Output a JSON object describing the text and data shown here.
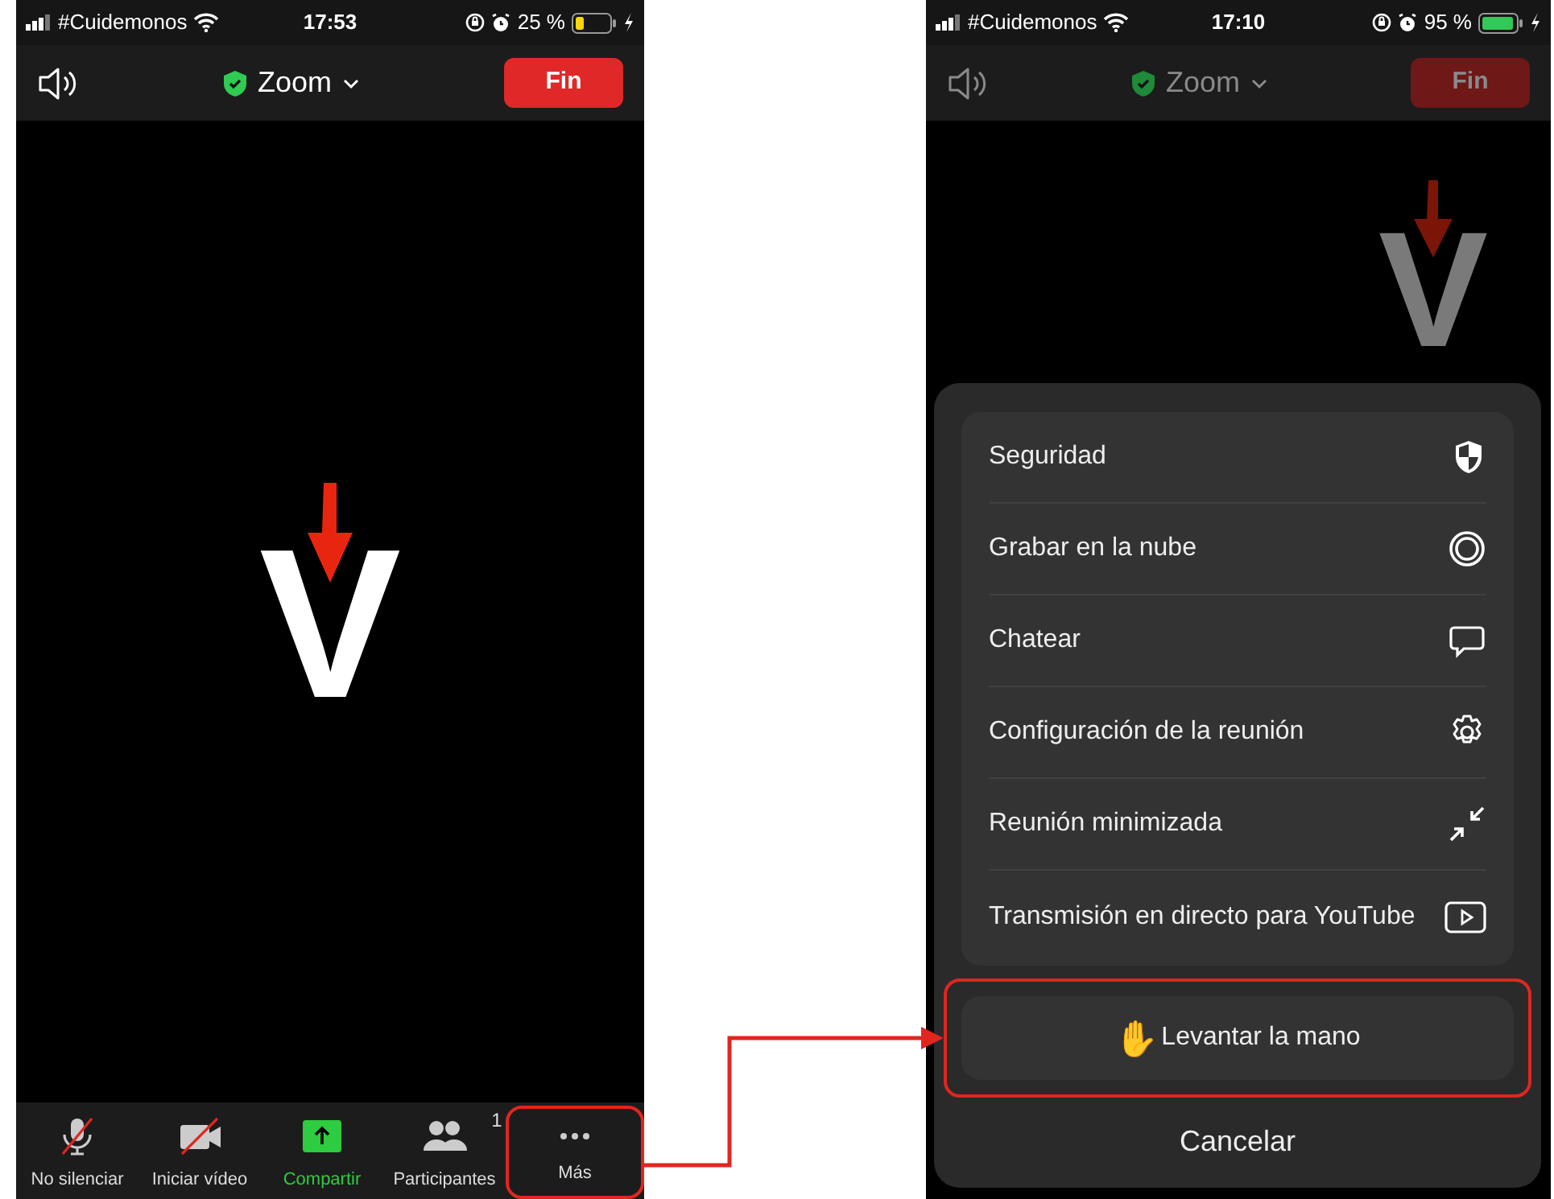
{
  "screens": [
    {
      "status_bar": {
        "carrier": "#Cuidemonos",
        "time": "17:53",
        "battery": {
          "text": "25 %",
          "color": "#ffd60a"
        }
      },
      "header": {
        "title": "Zoom",
        "end_button": "Fin",
        "dimmed": false
      },
      "video": {
        "avatar": "V",
        "dimmed": false
      },
      "toolbar": [
        {
          "kind": "mic",
          "label": "No silenciar",
          "highlighted": false
        },
        {
          "kind": "video",
          "label": "Iniciar vídeo",
          "highlighted": false
        },
        {
          "kind": "share",
          "label": "Compartir",
          "highlighted": false
        },
        {
          "kind": "participants",
          "label": "Participantes",
          "count": "1",
          "highlighted": false
        },
        {
          "kind": "more",
          "label": "Más",
          "highlighted": true
        }
      ]
    },
    {
      "status_bar": {
        "carrier": "#Cuidemonos",
        "time": "17:10",
        "battery": {
          "text": "95 %",
          "color": "#34c759"
        }
      },
      "header": {
        "title": "Zoom",
        "end_button": "Fin",
        "dimmed": true
      },
      "video": {
        "avatar": "V",
        "dimmed": true
      },
      "sheet": {
        "items": [
          {
            "kind": "security",
            "label": "Seguridad"
          },
          {
            "kind": "record",
            "label": "Grabar en la nube"
          },
          {
            "kind": "chat",
            "label": "Chatear"
          },
          {
            "kind": "settings",
            "label": "Configuración de la reunión"
          },
          {
            "kind": "minimize",
            "label": "Reunión minimizada"
          },
          {
            "kind": "youtube",
            "label": "Transmisión en directo para YouTube"
          }
        ],
        "raise_hand": {
          "emoji": "✋",
          "label": "Levantar la mano",
          "highlighted": true
        },
        "cancel": "Cancelar"
      }
    }
  ]
}
